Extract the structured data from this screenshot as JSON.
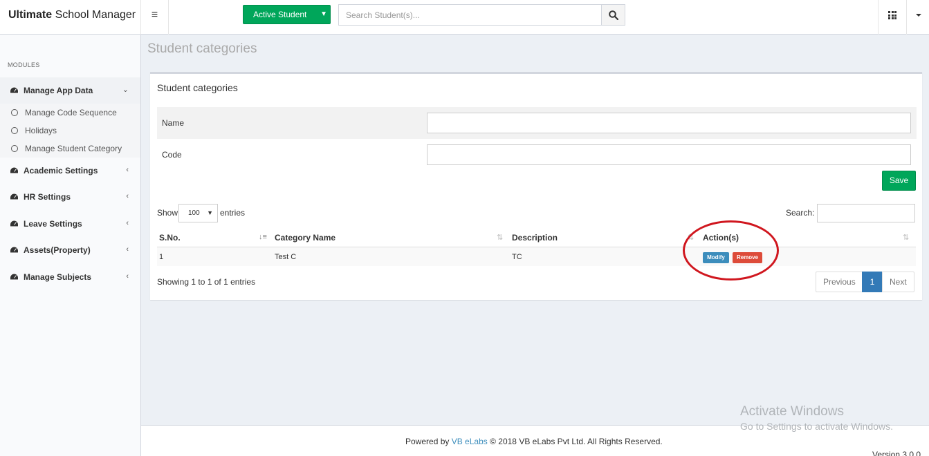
{
  "app": {
    "title_bold": "Ultimate",
    "title_rest": " School Manager"
  },
  "topbar": {
    "active_student_label": "Active Student",
    "search_placeholder": "Search Student(s)..."
  },
  "sidebar": {
    "modules_header": "MODULES",
    "manage_app_data": "Manage App Data",
    "sub_items": [
      "Manage Code Sequence",
      "Holidays",
      "Manage Student Category"
    ],
    "items": [
      "Academic Settings",
      "HR Settings",
      "Leave Settings",
      "Assets(Property)",
      "Manage Subjects"
    ]
  },
  "page": {
    "title": "Student categories"
  },
  "form": {
    "box_title": "Student categories",
    "name_label": "Name",
    "code_label": "Code",
    "name_value": "",
    "code_value": "",
    "save_label": "Save"
  },
  "table": {
    "show_label": "Show",
    "entries_value": "100",
    "entries_label": "entries",
    "search_label": "Search:",
    "columns": [
      "S.No.",
      "Category Name",
      "Description",
      "Action(s)"
    ],
    "rows": [
      {
        "sno": "1",
        "category_name": "Test C",
        "description": "TC"
      }
    ],
    "modify_label": "Modify",
    "remove_label": "Remove",
    "info": "Showing 1 to 1 of 1 entries",
    "pager": {
      "previous": "Previous",
      "current": "1",
      "next": "Next"
    }
  },
  "footer": {
    "powered_by": "Powered by",
    "link_text": "VB eLabs",
    "copyright": "© 2018 VB eLabs Pvt Ltd. All Rights Reserved.",
    "version": "Version 3.0.0"
  },
  "watermark": {
    "line1": "Activate Windows",
    "line2": "Go to Settings to activate Windows."
  },
  "colors": {
    "green": "#00a65a",
    "blue": "#3c8dbc",
    "red": "#dd4b39",
    "annotation": "#d0171f"
  }
}
